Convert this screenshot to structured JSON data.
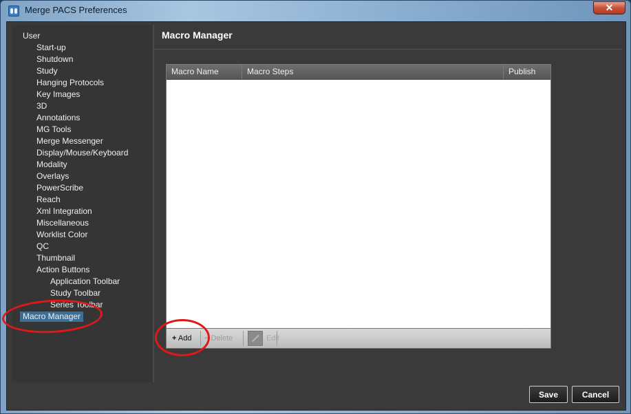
{
  "window": {
    "title": "Merge PACS Preferences",
    "close_glyph": "✕",
    "icon": "merge-pacs-app-icon"
  },
  "nav": {
    "items": [
      {
        "label": "User",
        "level": 0
      },
      {
        "label": "Start-up",
        "level": 1
      },
      {
        "label": "Shutdown",
        "level": 1
      },
      {
        "label": "Study",
        "level": 1
      },
      {
        "label": "Hanging Protocols",
        "level": 1
      },
      {
        "label": "Key Images",
        "level": 1
      },
      {
        "label": "3D",
        "level": 1
      },
      {
        "label": "Annotations",
        "level": 1
      },
      {
        "label": "MG Tools",
        "level": 1
      },
      {
        "label": "Merge Messenger",
        "level": 1
      },
      {
        "label": "Display/Mouse/Keyboard",
        "level": 1
      },
      {
        "label": "Modality",
        "level": 1
      },
      {
        "label": "Overlays",
        "level": 1
      },
      {
        "label": "PowerScribe",
        "level": 1
      },
      {
        "label": "Reach",
        "level": 1
      },
      {
        "label": "Xml Integration",
        "level": 1
      },
      {
        "label": "Miscellaneous",
        "level": 1
      },
      {
        "label": "Worklist Color",
        "level": 1
      },
      {
        "label": "QC",
        "level": 1
      },
      {
        "label": "Thumbnail",
        "level": 1
      },
      {
        "label": "Action Buttons",
        "level": 1
      },
      {
        "label": "Application Toolbar",
        "level": 2
      },
      {
        "label": "Study Toolbar",
        "level": 2
      },
      {
        "label": "Series Toolbar",
        "level": 2
      },
      {
        "label": "Macro Manager",
        "level": 0,
        "selected": true
      }
    ]
  },
  "panel": {
    "title": "Macro Manager",
    "table": {
      "columns": [
        "Macro Name",
        "Macro Steps",
        "Publish"
      ],
      "rows": []
    },
    "toolbar": {
      "add_glyph": "+",
      "add_label": "Add",
      "delete_glyph": "−",
      "delete_label": "Delete",
      "edit_label": "Edit"
    }
  },
  "buttons": {
    "save": "Save",
    "cancel": "Cancel"
  },
  "colors": {
    "selection": "#3b6f98",
    "annotation_ring": "#e01818"
  }
}
